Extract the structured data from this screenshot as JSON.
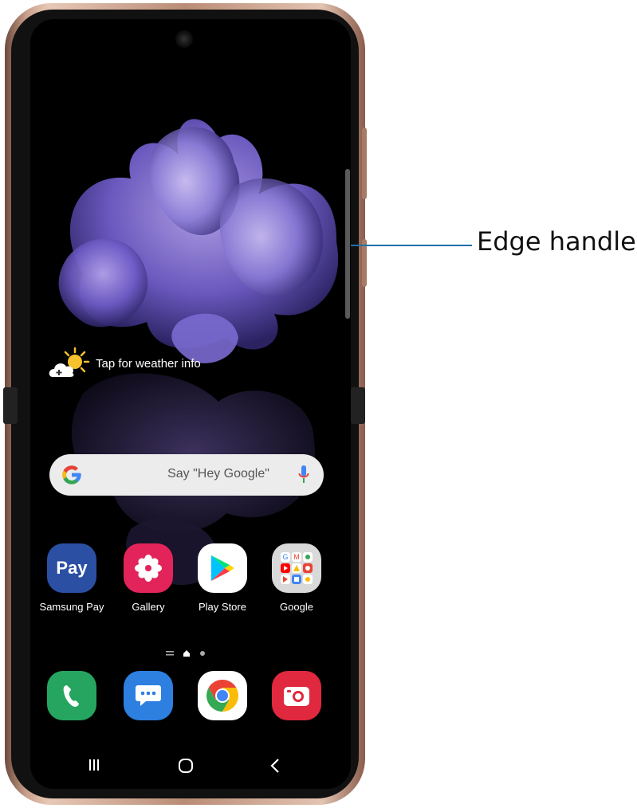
{
  "callout": {
    "label": "Edge handle"
  },
  "weather": {
    "text": "Tap for weather info",
    "icon": "weather-cloud-sun-icon"
  },
  "search": {
    "placeholder": "Say \"Hey Google\"",
    "logo": "google-g-icon",
    "mic_icon": "microphone-icon"
  },
  "home_apps": [
    {
      "label": "Samsung Pay",
      "icon": "samsung-pay-icon",
      "icon_text": "Pay",
      "color": "#2b4fa3"
    },
    {
      "label": "Gallery",
      "icon": "gallery-flower-icon",
      "color": "#e2245a"
    },
    {
      "label": "Play Store",
      "icon": "play-store-icon",
      "color": "#ffffff"
    },
    {
      "label": "Google",
      "icon": "google-folder-icon",
      "color": "#d9d9d9"
    }
  ],
  "page_indicator": {
    "pages": 3,
    "current": 2
  },
  "dock": [
    {
      "name": "Phone",
      "icon": "phone-icon",
      "color": "#25a55f"
    },
    {
      "name": "Messages",
      "icon": "messages-icon",
      "color": "#2d7fe0"
    },
    {
      "name": "Chrome",
      "icon": "chrome-icon",
      "color": "#ffffff"
    },
    {
      "name": "Camera",
      "icon": "camera-icon",
      "color": "#e0283f"
    }
  ],
  "nav_bar": {
    "recents": "recents-icon",
    "home": "home-icon",
    "back": "back-icon"
  }
}
